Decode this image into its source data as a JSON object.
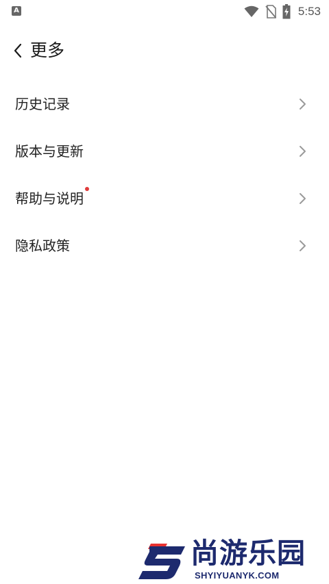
{
  "status_bar": {
    "left_icon": "A",
    "left_icon_name": "app-notification-icon",
    "icons": [
      "wifi-icon",
      "no-sim-icon",
      "battery-charging-icon"
    ],
    "time": "5:53"
  },
  "header": {
    "back_icon": "chevron-left-icon",
    "title": "更多"
  },
  "menu": {
    "items": [
      {
        "label": "历史记录",
        "badge": false
      },
      {
        "label": "版本与更新",
        "badge": false
      },
      {
        "label": "帮助与说明",
        "badge": true
      },
      {
        "label": "隐私政策",
        "badge": false
      }
    ],
    "chevron_icon": "chevron-right-icon"
  },
  "watermark": {
    "title": "尚游乐园",
    "subtitle": "SHYIYUANYK.COM"
  },
  "colors": {
    "background": "#ffffff",
    "text": "#222222",
    "chevron": "#9a9a9a",
    "badge_dot": "#e03b3b",
    "watermark_navy": "#1d2a6e",
    "watermark_red": "#e8312f"
  }
}
